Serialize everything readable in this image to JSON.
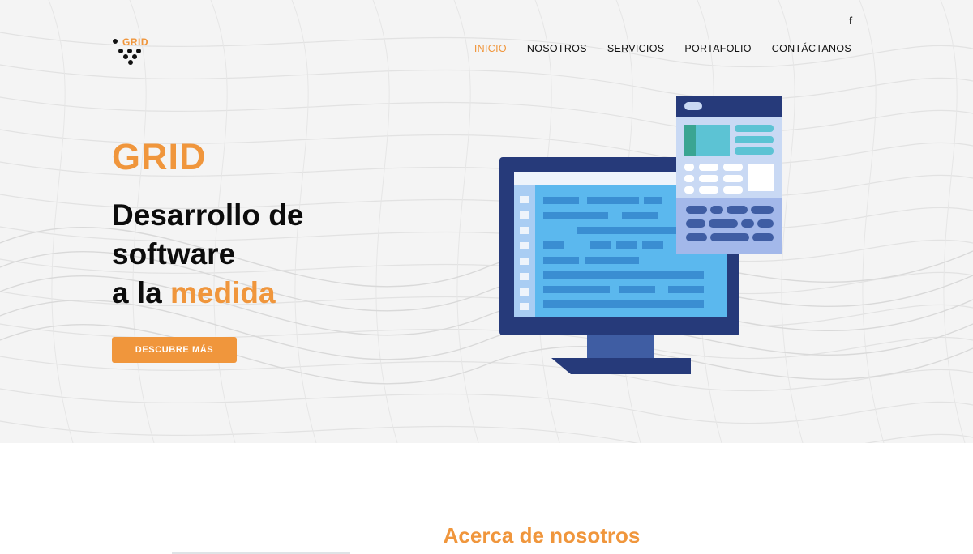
{
  "header": {
    "logo_text": "GRID",
    "facebook_label": "f",
    "nav": {
      "inicio": "INICIO",
      "nosotros": "NOSOTROS",
      "servicios": "SERVICIOS",
      "portafolio": "PORTAFOLIO",
      "contactanos": "CONTÁCTANOS"
    }
  },
  "hero": {
    "brand": "GRID",
    "headline_line1": "Desarrollo de",
    "headline_line2": "software",
    "headline_line3_prefix": "a la",
    "headline_line3_accent": "medida",
    "cta_label": "DESCUBRE MÁS"
  },
  "about": {
    "title": "Acerca de nosotros"
  },
  "colors": {
    "accent": "#f0963c",
    "text": "#0c0c0c",
    "monitor_frame": "#263a7a",
    "screen": "#5bb8ee",
    "panel": "#c9d9f4"
  },
  "icons": {
    "facebook": "facebook-icon",
    "logo": "grid-logo-icon"
  }
}
